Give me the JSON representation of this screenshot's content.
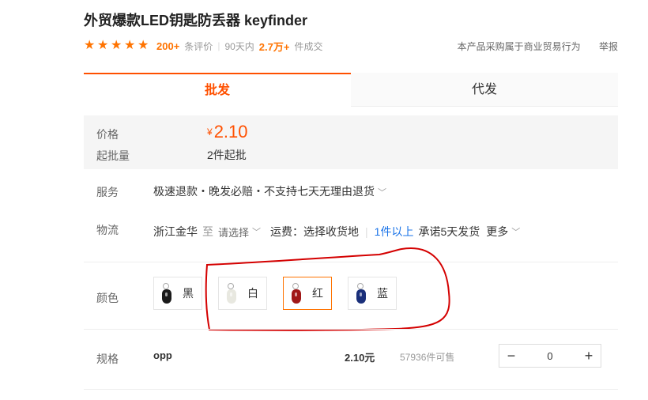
{
  "product": {
    "title": "外贸爆款LED钥匙防丢器 keyfinder"
  },
  "rating": {
    "stars": 5,
    "reviews_count": "200+",
    "reviews_label": "条评价",
    "period": "90天内",
    "sold_count": "2.7万+",
    "sold_label": "件成交"
  },
  "header_links": {
    "trade_notice": "本产品采购属于商业贸易行为",
    "report": "举报"
  },
  "tabs": [
    {
      "label": "批发",
      "active": true
    },
    {
      "label": "代发",
      "active": false
    }
  ],
  "price": {
    "label": "价格",
    "currency": "¥",
    "value": "2.10",
    "moq_label": "起批量",
    "moq_value": "2件起批"
  },
  "service": {
    "label": "服务",
    "value": "极速退款・晚发必赔・不支持七天无理由退货"
  },
  "logistics": {
    "label": "物流",
    "origin": "浙江金华",
    "to": "至",
    "destination_placeholder": "请选择",
    "freight": "运费：选择收货地",
    "min_qty": "1件以上",
    "promise": "承诺5天发货",
    "more": "更多"
  },
  "color": {
    "label": "颜色",
    "options": [
      {
        "name": "黑",
        "hex": "#1a1a1a",
        "selected": false
      },
      {
        "name": "白",
        "hex": "#e8e8e0",
        "selected": false
      },
      {
        "name": "红",
        "hex": "#a01818",
        "selected": true
      },
      {
        "name": "蓝",
        "hex": "#1a2f7a",
        "selected": false
      }
    ]
  },
  "spec": {
    "label": "规格",
    "name": "opp",
    "price": "2.10元",
    "stock": "57936件可售",
    "quantity": "0",
    "minus": "−",
    "plus": "+"
  },
  "colors": {
    "accent": "#ff5000",
    "star": "#ff7300",
    "annotation": "#d40000"
  }
}
